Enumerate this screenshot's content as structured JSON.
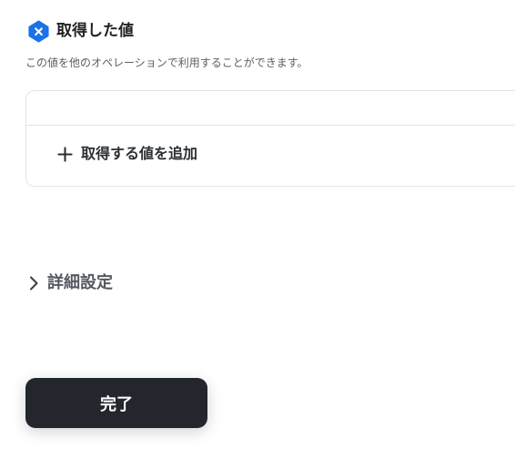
{
  "section": {
    "title": "取得した値",
    "description": "この値を他のオペレーションで利用することができます。",
    "badge_icon": "x-badge-icon",
    "accent_color": "#1A73E8"
  },
  "values_card": {
    "add_label": "取得する値を追加",
    "add_icon": "plus-icon"
  },
  "advanced": {
    "label": "詳細設定",
    "icon": "chevron-right-icon"
  },
  "footer": {
    "done_label": "完了",
    "done_color": "#23262C"
  }
}
